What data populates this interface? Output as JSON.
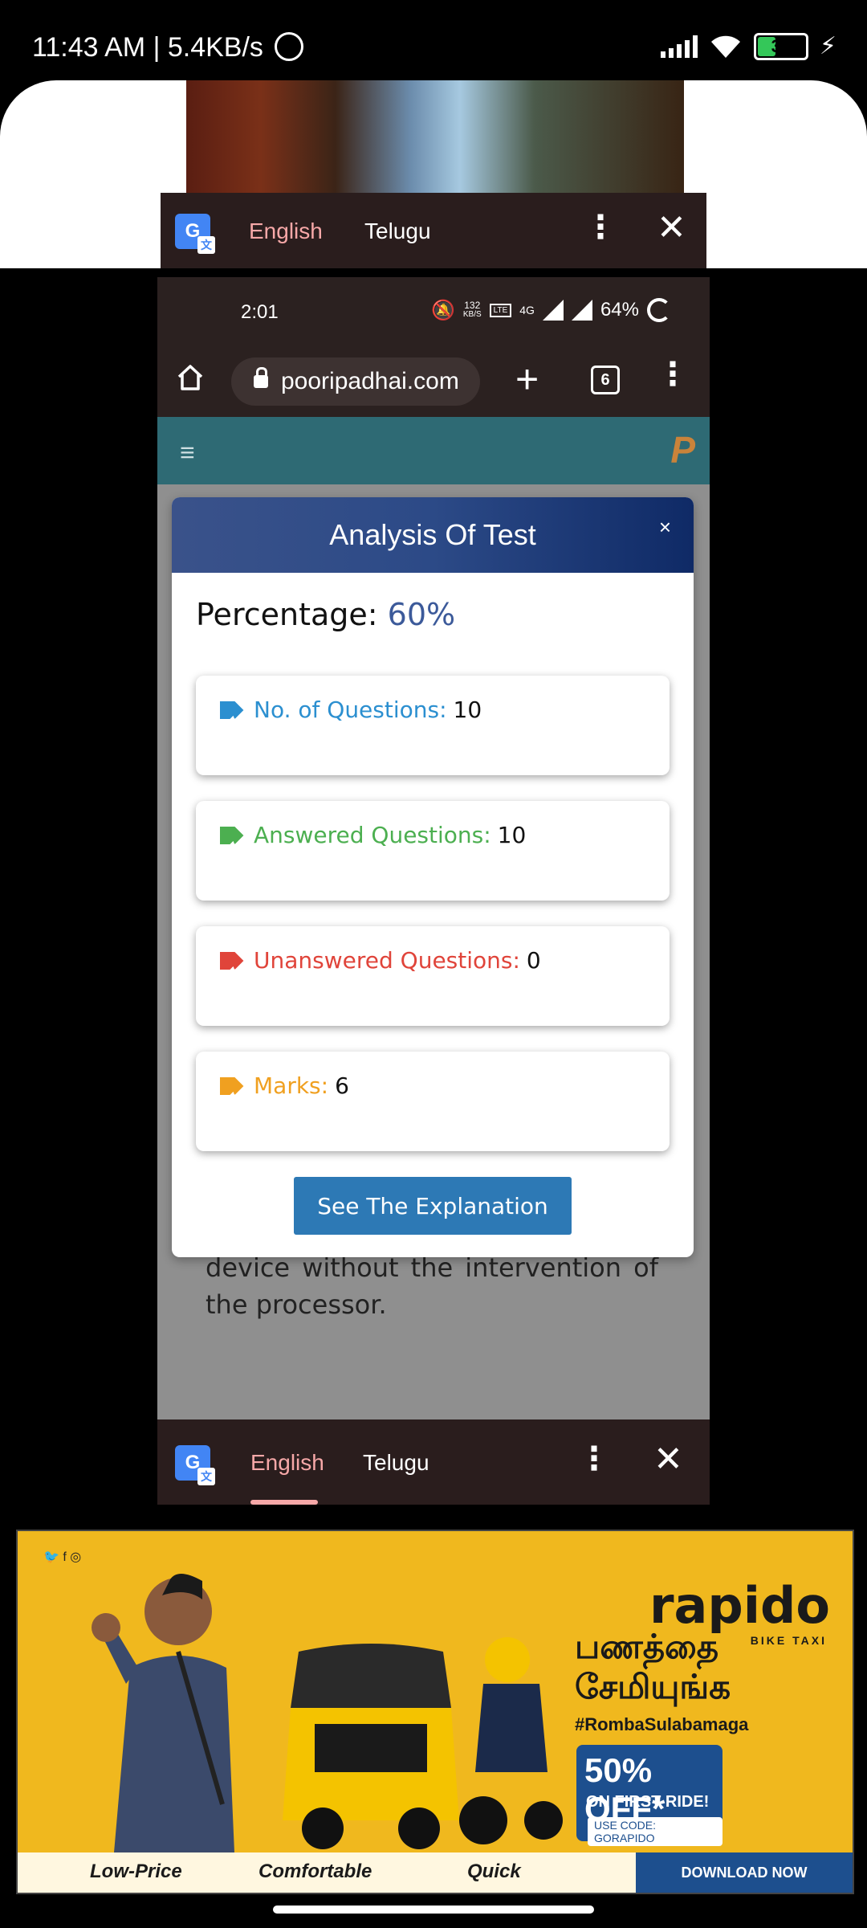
{
  "status_bar": {
    "time_text": "11:43 AM | 5.4KB/s",
    "battery": "36"
  },
  "translate_bar_top": {
    "lang_from": "English",
    "lang_to": "Telugu"
  },
  "inner_phone": {
    "status": {
      "time": "2:01",
      "speed_top": "132",
      "speed_unit": "KB/S",
      "network": "4G",
      "battery": "64%"
    },
    "browser": {
      "url": "pooripadhai.com",
      "tab_count": "6"
    },
    "page": {
      "logo": "P",
      "background_text": "between memory and the external device without the intervention of the processor."
    },
    "modal": {
      "title": "Analysis Of Test",
      "close": "×",
      "percentage_label": "Percentage:",
      "percentage_value": "60%",
      "stats": [
        {
          "label": "No. of Questions:",
          "value": "10",
          "color": "#2b8fd0"
        },
        {
          "label": "Answered Questions:",
          "value": "10",
          "color": "#4caf50"
        },
        {
          "label": "Unanswered Questions:",
          "value": "0",
          "color": "#e0443a"
        },
        {
          "label": "Marks:",
          "value": "6",
          "color": "#f0a020"
        }
      ],
      "button": "See The Explanation"
    },
    "translate_bar_bottom": {
      "lang_from": "English",
      "lang_to": "Telugu"
    }
  },
  "ad": {
    "brand": "rapido",
    "brand_sub": "BIKE TAXI",
    "tamil_line1": "பணத்தை",
    "tamil_line2": "சேமியுங்க",
    "hashtag": "#RombaSulabamaga",
    "offer_big": "50% OFF*",
    "offer_ride": "ON FIRST RIDE!",
    "offer_code": "USE CODE: GORAPIDO",
    "features": [
      "Low-Price",
      "Comfortable",
      "Quick"
    ],
    "download": "DOWNLOAD NOW",
    "colors": {
      "background": "#f0b81e",
      "accent": "#1d4f8e"
    }
  }
}
